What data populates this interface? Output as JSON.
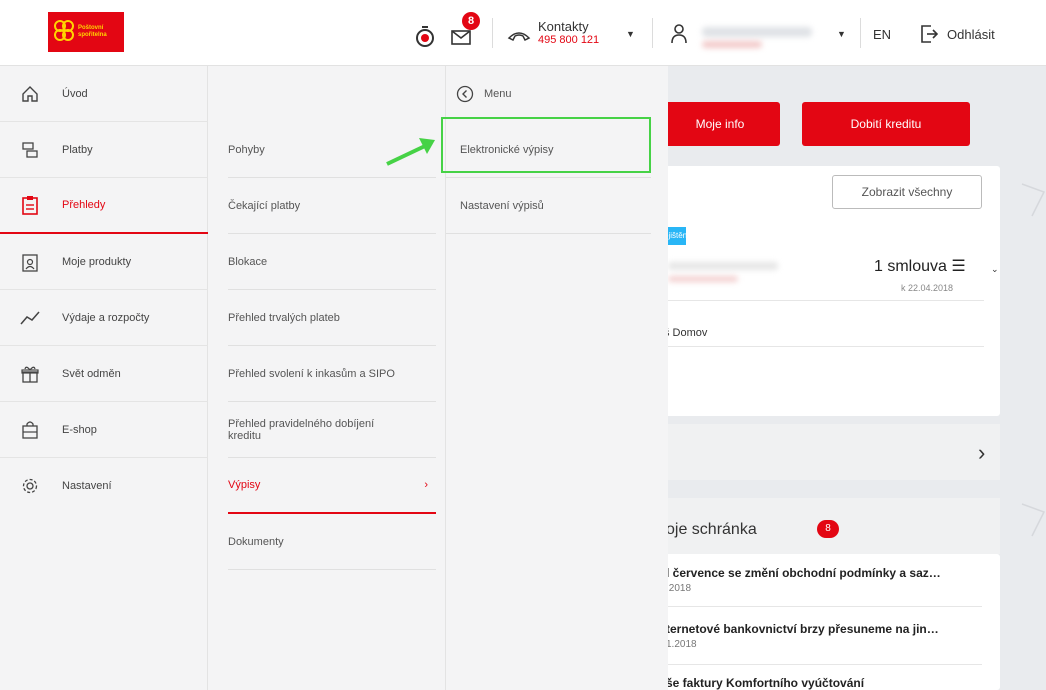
{
  "header": {
    "logo_text": "Poštovní\nspořitelna",
    "notifications_count": "8",
    "contacts_label": "Kontakty",
    "contacts_phone": "495 800 121",
    "language": "EN",
    "logout_label": "Odhlásit"
  },
  "menu_primary": [
    {
      "label": "Úvod",
      "icon": "home-icon"
    },
    {
      "label": "Platby",
      "icon": "coins-icon"
    },
    {
      "label": "Přehledy",
      "icon": "clipboard-icon",
      "active": true
    },
    {
      "label": "Moje produkty",
      "icon": "user-card-icon"
    },
    {
      "label": "Výdaje a rozpočty",
      "icon": "trend-icon"
    },
    {
      "label": "Svět odměn",
      "icon": "gift-icon"
    },
    {
      "label": "E-shop",
      "icon": "shopping-bag-icon"
    },
    {
      "label": "Nastavení",
      "icon": "gear-icon"
    }
  ],
  "menu_secondary": [
    {
      "label": "Pohyby"
    },
    {
      "label": "Čekající platby"
    },
    {
      "label": "Blokace"
    },
    {
      "label": "Přehled trvalých plateb"
    },
    {
      "label": "Přehled svolení k inkasům a SIPO"
    },
    {
      "label": "Přehled pravidelného dobíjení kreditu"
    },
    {
      "label": "Výpisy",
      "active": true
    },
    {
      "label": "Dokumenty"
    }
  ],
  "menu_tertiary": {
    "back_label": "Menu",
    "items": [
      {
        "label": "Elektronické výpisy"
      },
      {
        "label": "Nastavení výpisů"
      }
    ]
  },
  "content": {
    "my_info_button": "Moje info",
    "top_up_button": "Dobití kreditu",
    "show_all_button": "Zobrazit všechny",
    "tag_label": "ojištění",
    "contracts": "1 smlouva ☰",
    "contracts_date": "k 22.04.2018",
    "product_name": "š Domov",
    "mailbox_title": "oje schránka",
    "mailbox_count": "8",
    "mails": [
      {
        "subject": "l července se změní obchodní podmínky a saz…",
        "date": ".2018"
      },
      {
        "subject": "ternetové bankovnictví brzy přesuneme na jin…",
        "date": "1.2018"
      },
      {
        "subject": "še faktury Komfortního vyúčtování",
        "date": ""
      }
    ]
  },
  "colors": {
    "brand_red": "#e30613",
    "highlight_green": "#46d246",
    "tag_blue": "#29b6f6"
  }
}
